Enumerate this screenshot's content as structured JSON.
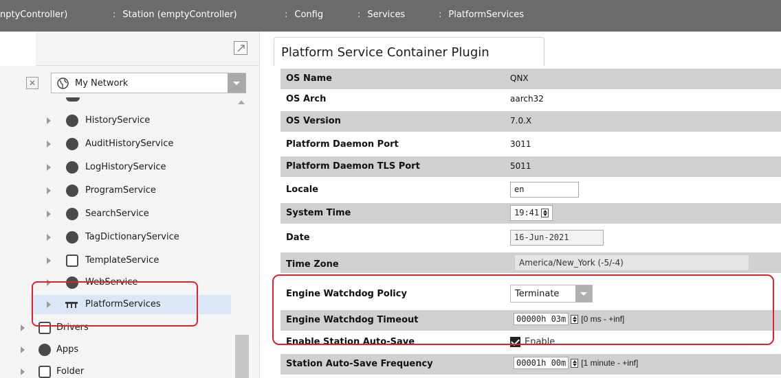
{
  "breadcrumb": [
    {
      "label": "nptyController)",
      "sep": ""
    },
    {
      "label": "Station (emptyController)",
      "sep": ":"
    },
    {
      "label": "Config",
      "sep": ":"
    },
    {
      "label": "Services",
      "sep": ":"
    },
    {
      "label": "PlatformServices",
      "sep": ":"
    }
  ],
  "nav": {
    "network_label": "My Network",
    "items": [
      {
        "label": "HistoryService",
        "icon": "history-icon"
      },
      {
        "label": "AuditHistoryService",
        "icon": "audit-history-icon"
      },
      {
        "label": "LogHistoryService",
        "icon": "log-history-icon"
      },
      {
        "label": "ProgramService",
        "icon": "program-icon"
      },
      {
        "label": "SearchService",
        "icon": "search-service-icon"
      },
      {
        "label": "TagDictionaryService",
        "icon": "tag-dictionary-icon"
      },
      {
        "label": "TemplateService",
        "icon": "template-icon"
      },
      {
        "label": "WebService",
        "icon": "web-icon"
      },
      {
        "label": "PlatformServices",
        "icon": "platform-services-icon"
      },
      {
        "label": "Drivers",
        "icon": "drivers-icon"
      },
      {
        "label": "Apps",
        "icon": "apps-icon"
      },
      {
        "label": "Folder",
        "icon": "folder-icon"
      }
    ]
  },
  "plugin": {
    "title": "Platform Service Container Plugin",
    "props": {
      "os_name": {
        "name": "OS Name",
        "value": "QNX"
      },
      "os_arch": {
        "name": "OS Arch",
        "value": "aarch32"
      },
      "os_version": {
        "name": "OS Version",
        "value": "7.0.X"
      },
      "daemon_port": {
        "name": "Platform Daemon Port",
        "value": "3011"
      },
      "daemon_tls_port": {
        "name": "Platform Daemon TLS Port",
        "value": "5011"
      },
      "locale": {
        "name": "Locale",
        "value": "en"
      },
      "system_time": {
        "name": "System Time",
        "value": "19:41"
      },
      "date": {
        "name": "Date",
        "value": "16-Jun-2021"
      },
      "time_zone": {
        "name": "Time Zone",
        "value": "America/New_York (-5/-4)"
      },
      "watchdog_policy": {
        "name": "Engine Watchdog Policy",
        "value": "Terminate"
      },
      "watchdog_timeout": {
        "name": "Engine Watchdog Timeout",
        "value": "00000h 03m",
        "range": "[0 ms - +inf]"
      },
      "auto_save": {
        "name": "Enable Station Auto-Save",
        "value": "Enable"
      },
      "auto_save_freq": {
        "name": "Station Auto-Save Frequency",
        "value": "00001h 00m",
        "range": "[1 minute - +inf]"
      }
    }
  },
  "colors": {
    "breadcrumb_bg": "#6b6b6b",
    "row_shade": "#d0d0d0",
    "selection": "#dbe7f7",
    "highlight": "#d9232d"
  }
}
